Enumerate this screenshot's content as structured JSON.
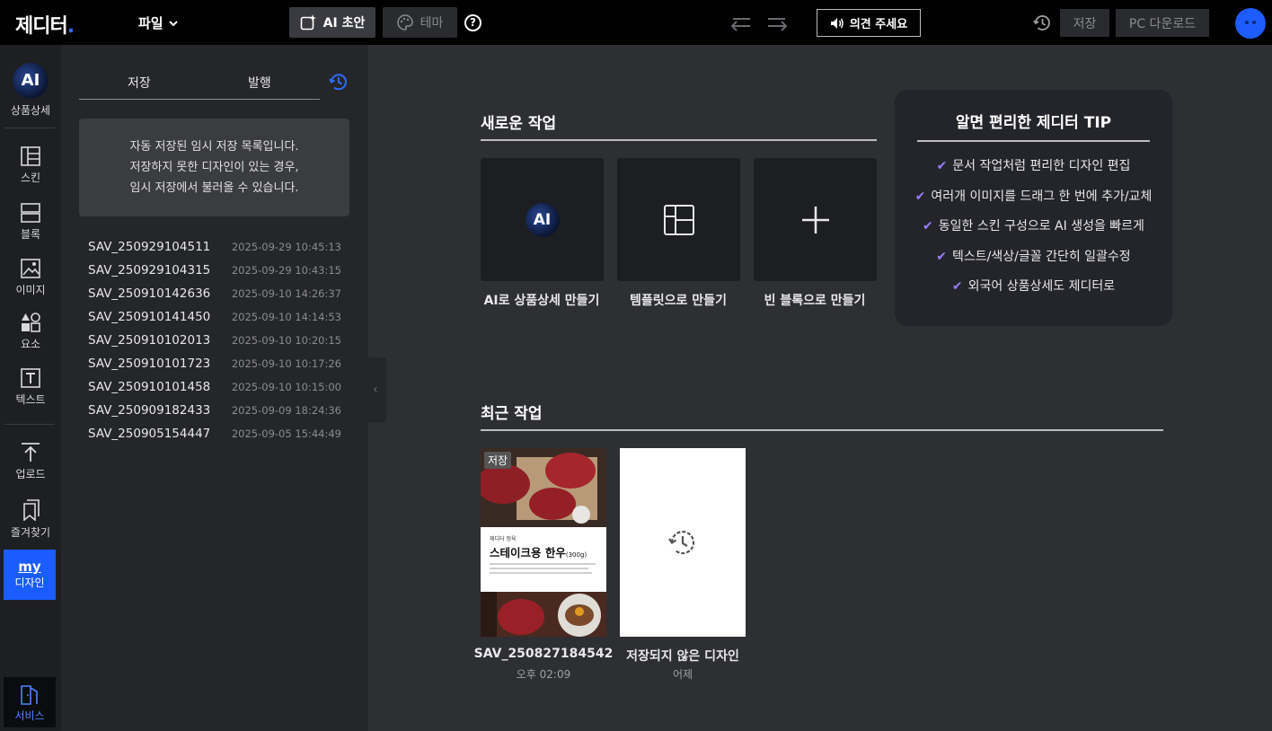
{
  "topbar": {
    "logo": "제디터",
    "file_menu": "파일",
    "ai_button": "AI 초안",
    "theme_button": "테마",
    "help": "?",
    "feedback": "의견 주세요",
    "save": "저장",
    "pc_download": "PC 다운로드"
  },
  "rail": {
    "ai_badge": "AI",
    "product_detail": "상품상세",
    "skin": "스킨",
    "block": "블록",
    "image": "이미지",
    "element": "요소",
    "text": "텍스트",
    "upload": "업로드",
    "favorites": "즐겨찾기",
    "my_logo": "my",
    "my_design": "디자인",
    "service": "서비스"
  },
  "panel": {
    "tab_save": "저장",
    "tab_publish": "발행",
    "notice": [
      "자동 저장된 임시 저장 목록입니다.",
      "저장하지 못한 디자인이 있는 경우,",
      "임시 저장에서 불러올 수 있습니다."
    ],
    "files": [
      {
        "name": "SAV_250929104511",
        "date": "2025-09-29 10:45:13"
      },
      {
        "name": "SAV_250929104315",
        "date": "2025-09-29 10:43:15"
      },
      {
        "name": "SAV_250910142636",
        "date": "2025-09-10 14:26:37"
      },
      {
        "name": "SAV_250910141450",
        "date": "2025-09-10 14:14:53"
      },
      {
        "name": "SAV_250910102013",
        "date": "2025-09-10 10:20:15"
      },
      {
        "name": "SAV_250910101723",
        "date": "2025-09-10 10:17:26"
      },
      {
        "name": "SAV_250910101458",
        "date": "2025-09-10 10:15:00"
      },
      {
        "name": "SAV_250909182433",
        "date": "2025-09-09 18:24:36"
      },
      {
        "name": "SAV_250905154447",
        "date": "2025-09-05 15:44:49"
      }
    ]
  },
  "main": {
    "new_work_title": "새로운 작업",
    "ai_card_badge": "AI",
    "card_ai": "AI로 상품상세 만들기",
    "card_template": "템플릿으로 만들기",
    "card_blank": "빈 블록으로 만들기",
    "recent_title": "최근 작업",
    "recent": [
      {
        "name": "SAV_250827184542",
        "time": "오후 02:09",
        "badge": "저장",
        "thumb_brand": "제디터 정육",
        "thumb_title": "스테이크용 한우",
        "thumb_weight": "(300g)"
      },
      {
        "name": "저장되지 않은 디자인",
        "time": "어제"
      }
    ]
  },
  "tip": {
    "title": "알면 편리한 제디터 TIP",
    "items": [
      "문서 작업처럼 편리한 디자인 편집",
      "여러개 이미지를 드래그 한 번에 추가/교체",
      "동일한 스킨 구성으로 AI 생성을 빠르게",
      "텍스트/색상/글꼴 간단히 일괄수정",
      "외국어 상품상세도 제디터로"
    ]
  },
  "colors": {
    "accent": "#1b5cff",
    "check": "#9a7cff"
  }
}
